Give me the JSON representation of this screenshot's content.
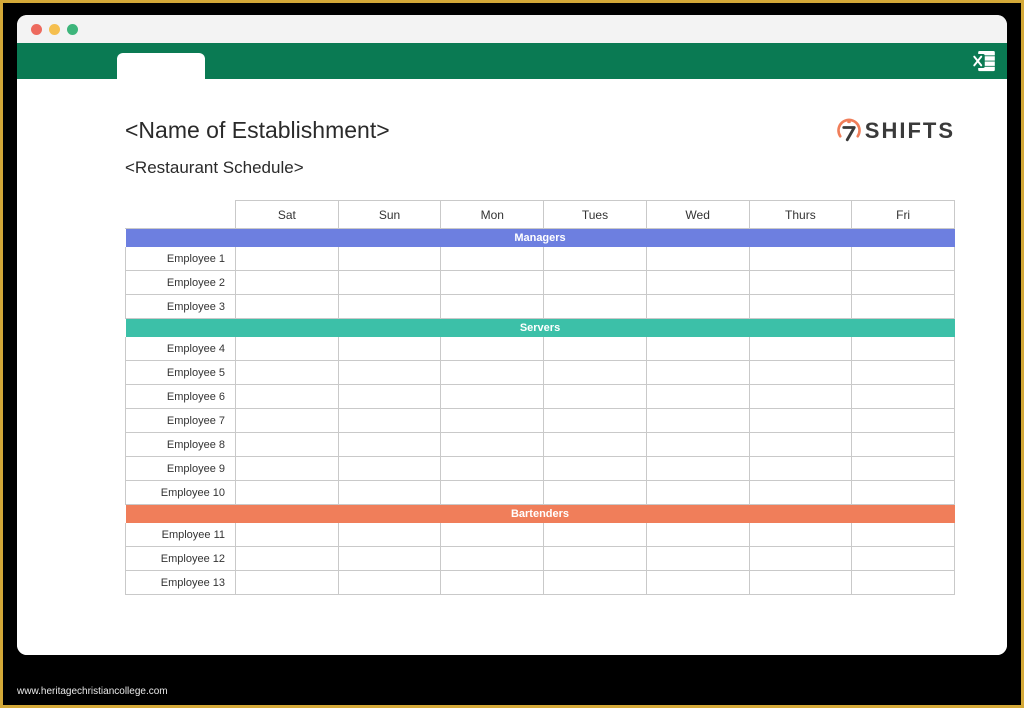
{
  "window": {
    "traffic_lights": [
      "close",
      "minimize",
      "zoom"
    ]
  },
  "ribbon": {
    "color": "#0a7a53",
    "app_icon": "excel-icon"
  },
  "document": {
    "title": "<Name of Establishment>",
    "subtitle": "<Restaurant Schedule>"
  },
  "brand": {
    "name": "7SHIFTS",
    "text": "SHIFTS",
    "accent": "#f07e5a"
  },
  "schedule": {
    "days": [
      "Sat",
      "Sun",
      "Mon",
      "Tues",
      "Wed",
      "Thurs",
      "Fri"
    ],
    "groups": [
      {
        "name": "Managers",
        "color": "#6d7fe0",
        "employees": [
          "Employee 1",
          "Employee 2",
          "Employee 3"
        ]
      },
      {
        "name": "Servers",
        "color": "#3cc0a8",
        "employees": [
          "Employee 4",
          "Employee 5",
          "Employee 6",
          "Employee 7",
          "Employee 8",
          "Employee 9",
          "Employee 10"
        ]
      },
      {
        "name": "Bartenders",
        "color": "#f07e5a",
        "employees": [
          "Employee 11",
          "Employee 12",
          "Employee 13"
        ]
      }
    ]
  },
  "watermark": "www.heritagechristiancollege.com"
}
